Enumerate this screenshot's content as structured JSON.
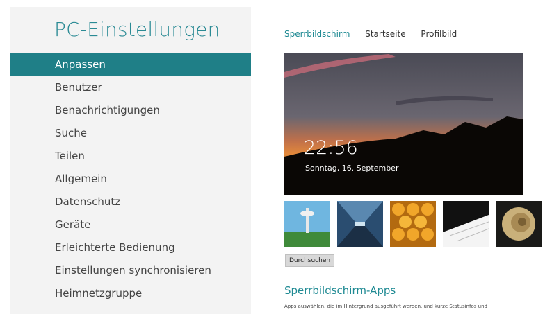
{
  "sidebar": {
    "title": "PC-Einstellungen",
    "items": [
      {
        "label": "Anpassen",
        "active": true
      },
      {
        "label": "Benutzer"
      },
      {
        "label": "Benachrichtigungen"
      },
      {
        "label": "Suche"
      },
      {
        "label": "Teilen"
      },
      {
        "label": "Allgemein"
      },
      {
        "label": "Datenschutz"
      },
      {
        "label": "Geräte"
      },
      {
        "label": "Erleichterte Bedienung"
      },
      {
        "label": "Einstellungen synchronisieren"
      },
      {
        "label": "Heimnetzgruppe"
      }
    ]
  },
  "main": {
    "tabs": [
      {
        "label": "Sperrbildschirm",
        "active": true
      },
      {
        "label": "Startseite"
      },
      {
        "label": "Profilbild"
      }
    ],
    "lock_preview": {
      "time": "22:56",
      "date": "Sonntag, 16. September"
    },
    "thumbnails": [
      {
        "name": "space-needle-thumbnail"
      },
      {
        "name": "tunnel-thumbnail"
      },
      {
        "name": "honeycomb-thumbnail"
      },
      {
        "name": "piano-keys-thumbnail"
      },
      {
        "name": "nautilus-shell-thumbnail"
      }
    ],
    "browse_label": "Durchsuchen",
    "apps_title": "Sperrbildschirm-Apps",
    "apps_description": "Apps auswählen, die im Hintergrund ausgeführt werden, und kurze Statusinfos und"
  },
  "colors": {
    "accent": "#1f7f87",
    "accent_text": "#1f8a93",
    "sidebar_bg": "#f3f3f3"
  }
}
